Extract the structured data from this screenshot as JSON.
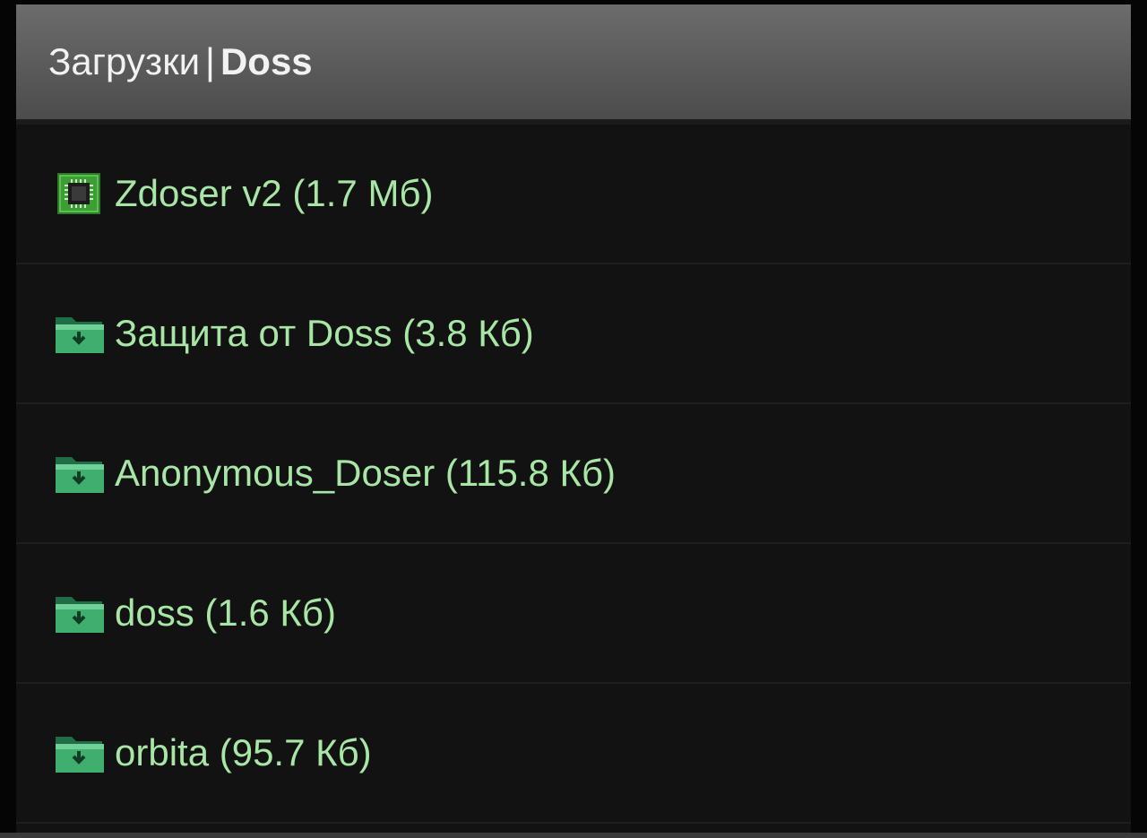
{
  "header": {
    "section": "Загрузки",
    "separator": "|",
    "current": "Doss"
  },
  "items": [
    {
      "label": "Zdoser v2 (1.7 Мб)",
      "icon": "app-chip-icon"
    },
    {
      "label": "Защита от Doss (3.8 Кб)",
      "icon": "folder-download-icon"
    },
    {
      "label": "Anonymous_Doser (115.8 Кб)",
      "icon": "folder-download-icon"
    },
    {
      "label": "doss (1.6 Кб)",
      "icon": "folder-download-icon"
    },
    {
      "label": "orbita (95.7 Кб)",
      "icon": "folder-download-icon"
    }
  ],
  "colors": {
    "item_text": "#a8e6a6",
    "header_text": "#f2f2f2",
    "background": "#121212",
    "folder_green": "#2f9a5e"
  }
}
